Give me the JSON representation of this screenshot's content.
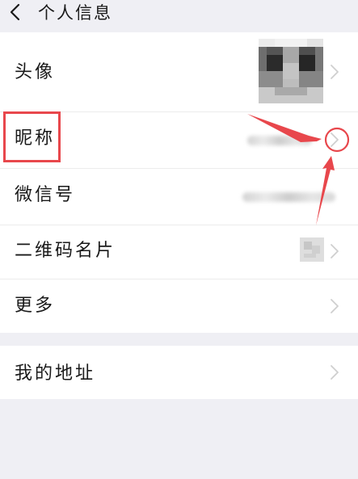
{
  "nav": {
    "back_icon": "chevron-left-icon",
    "title": "个人信息"
  },
  "rows": [
    {
      "label": "头像",
      "value": ""
    },
    {
      "label": "昵称",
      "value": ""
    },
    {
      "label": "微信号",
      "value": ""
    },
    {
      "label": "二维码名片",
      "value": ""
    },
    {
      "label": "更多",
      "value": ""
    },
    {
      "label": "我的地址",
      "value": ""
    }
  ],
  "icons": {
    "row_arrow": "chevron-right-icon",
    "qr": "qr-code-icon"
  },
  "colors": {
    "background": "#efeff4",
    "card": "#ffffff",
    "annotation_red": "#e8474c"
  }
}
